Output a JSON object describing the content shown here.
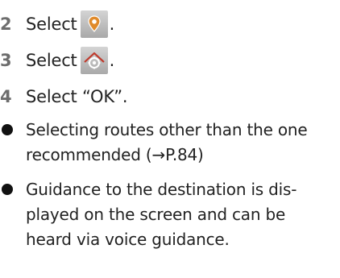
{
  "steps": [
    {
      "number": "2",
      "text": "Select",
      "icon": "map-pin-icon",
      "suffix": "."
    },
    {
      "number": "3",
      "text": "Select",
      "icon": "route-settings-icon",
      "suffix": "."
    },
    {
      "number": "4",
      "text": "Select “OK”."
    }
  ],
  "bullets": [
    {
      "lines": [
        "Selecting routes other than the one",
        "recommended (→P.84)"
      ]
    },
    {
      "lines": [
        "Guidance to the destination is dis-",
        "played on the screen and can be",
        "heard via voice guidance."
      ]
    }
  ],
  "colors": {
    "step_number": "#6d6d6d",
    "text": "#222222",
    "icon_background": "#b5b5b5",
    "map_pin_icon": "#e08a2a",
    "route_settings_icon": "#c0392b",
    "bullet": "#111111"
  }
}
